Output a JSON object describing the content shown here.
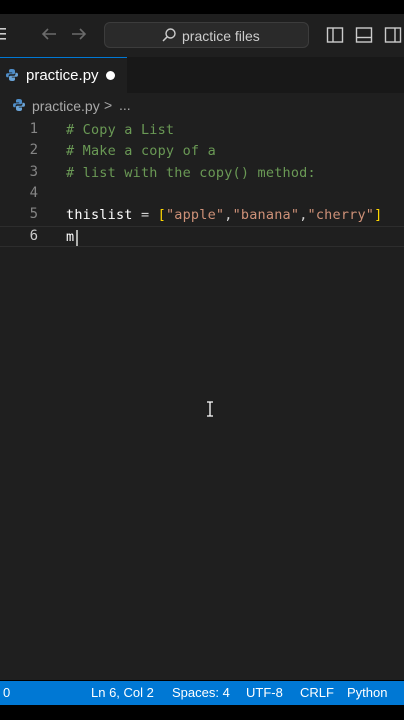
{
  "window": {
    "search_text": "practice files"
  },
  "tab": {
    "label": "practice.py",
    "modified": true
  },
  "breadcrumb": {
    "file": "practice.py",
    "separator": ">",
    "more": "..."
  },
  "editor": {
    "lines": [
      {
        "number": "1",
        "text": "# Copy a List"
      },
      {
        "number": "2",
        "text": "# Make a copy of a"
      },
      {
        "number": "3",
        "text": "# list with the copy() method:"
      },
      {
        "number": "4",
        "text": ""
      },
      {
        "number": "5",
        "name": "thislist",
        "op": " = ",
        "open": "[",
        "items": [
          "\"apple\"",
          ",",
          "\"banana\"",
          ",",
          "\"cherry\""
        ],
        "close": "]"
      },
      {
        "number": "6",
        "text": "m"
      }
    ]
  },
  "status": {
    "left": "0",
    "position": "Ln 6, Col 2",
    "spaces": "Spaces: 4",
    "encoding": "UTF-8",
    "eol": "CRLF",
    "language": "Python"
  },
  "colors": {
    "accent": "#0078d4",
    "editor_bg": "#1f1f1f",
    "comment": "#6a9955",
    "string": "#ce9178",
    "bracket": "#ffd700"
  }
}
